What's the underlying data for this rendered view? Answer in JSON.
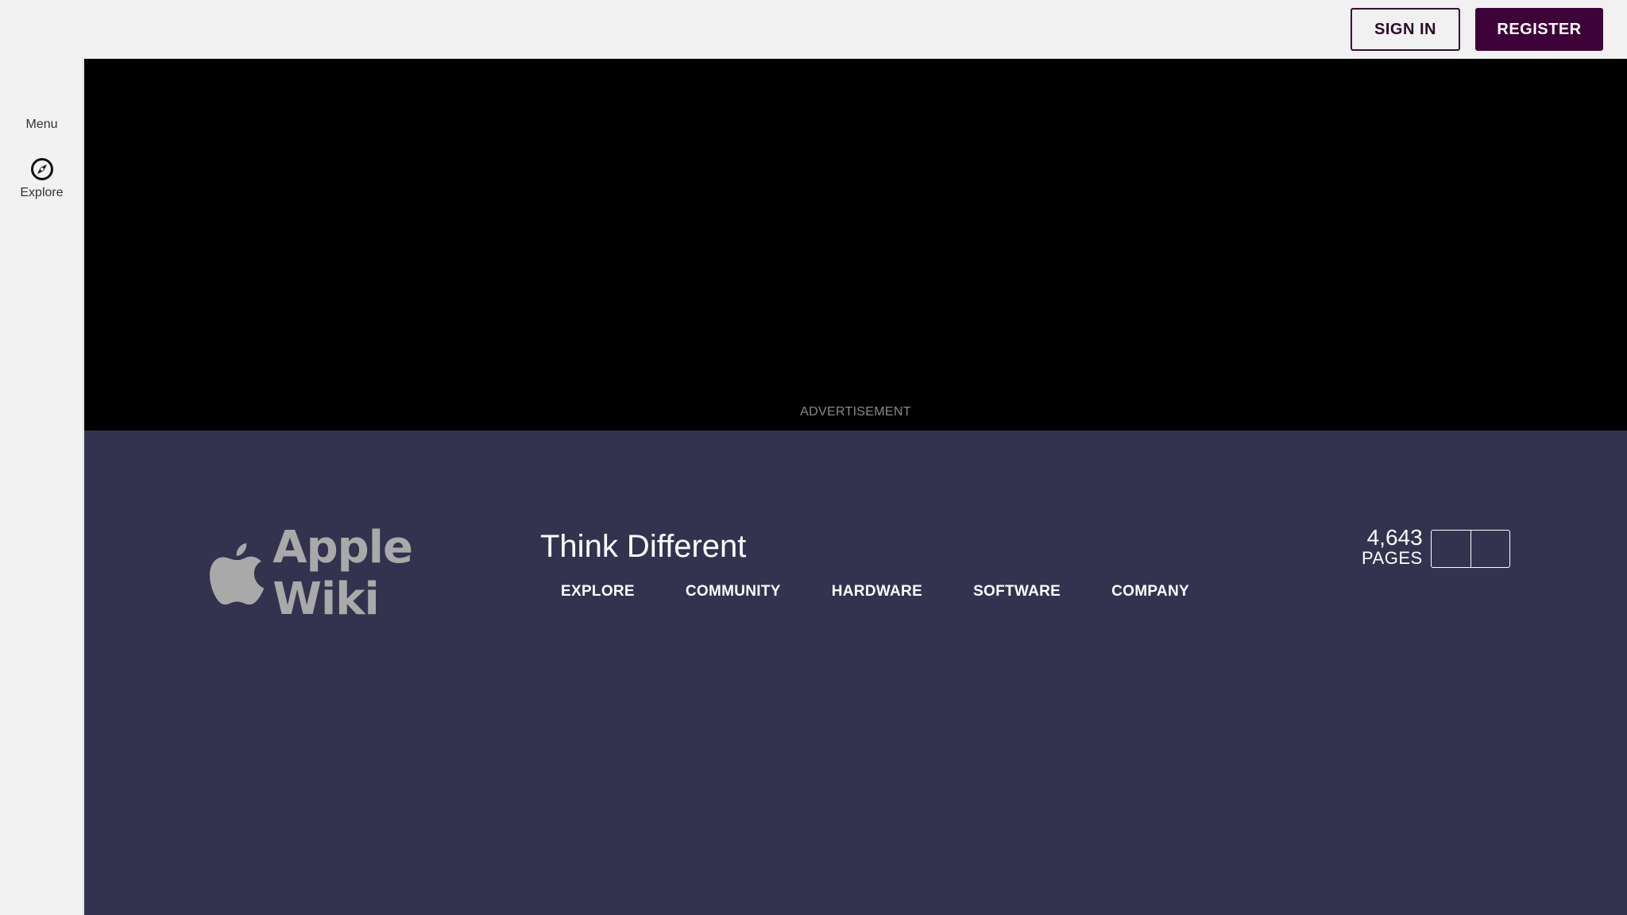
{
  "topbar": {
    "signin_label": "SIGN IN",
    "register_label": "REGISTER"
  },
  "rail": {
    "menu_label": "Menu",
    "explore_label": "Explore",
    "explore_icon": "compass-icon"
  },
  "ad": {
    "label": "ADVERTISEMENT"
  },
  "header": {
    "logo_text": "Apple Wiki",
    "logo_icon": "apple-logo-icon",
    "title": "Think Different",
    "nav": [
      {
        "label": "EXPLORE"
      },
      {
        "label": "COMMUNITY"
      },
      {
        "label": "HARDWARE"
      },
      {
        "label": "SOFTWARE"
      },
      {
        "label": "COMPANY"
      }
    ],
    "stats": {
      "count": "4,643",
      "label": "PAGES"
    }
  },
  "colors": {
    "header_bg": "#333350",
    "register_bg": "#3d0238",
    "ad_bg": "#000000",
    "logo_gray": "#a9a9a9"
  }
}
